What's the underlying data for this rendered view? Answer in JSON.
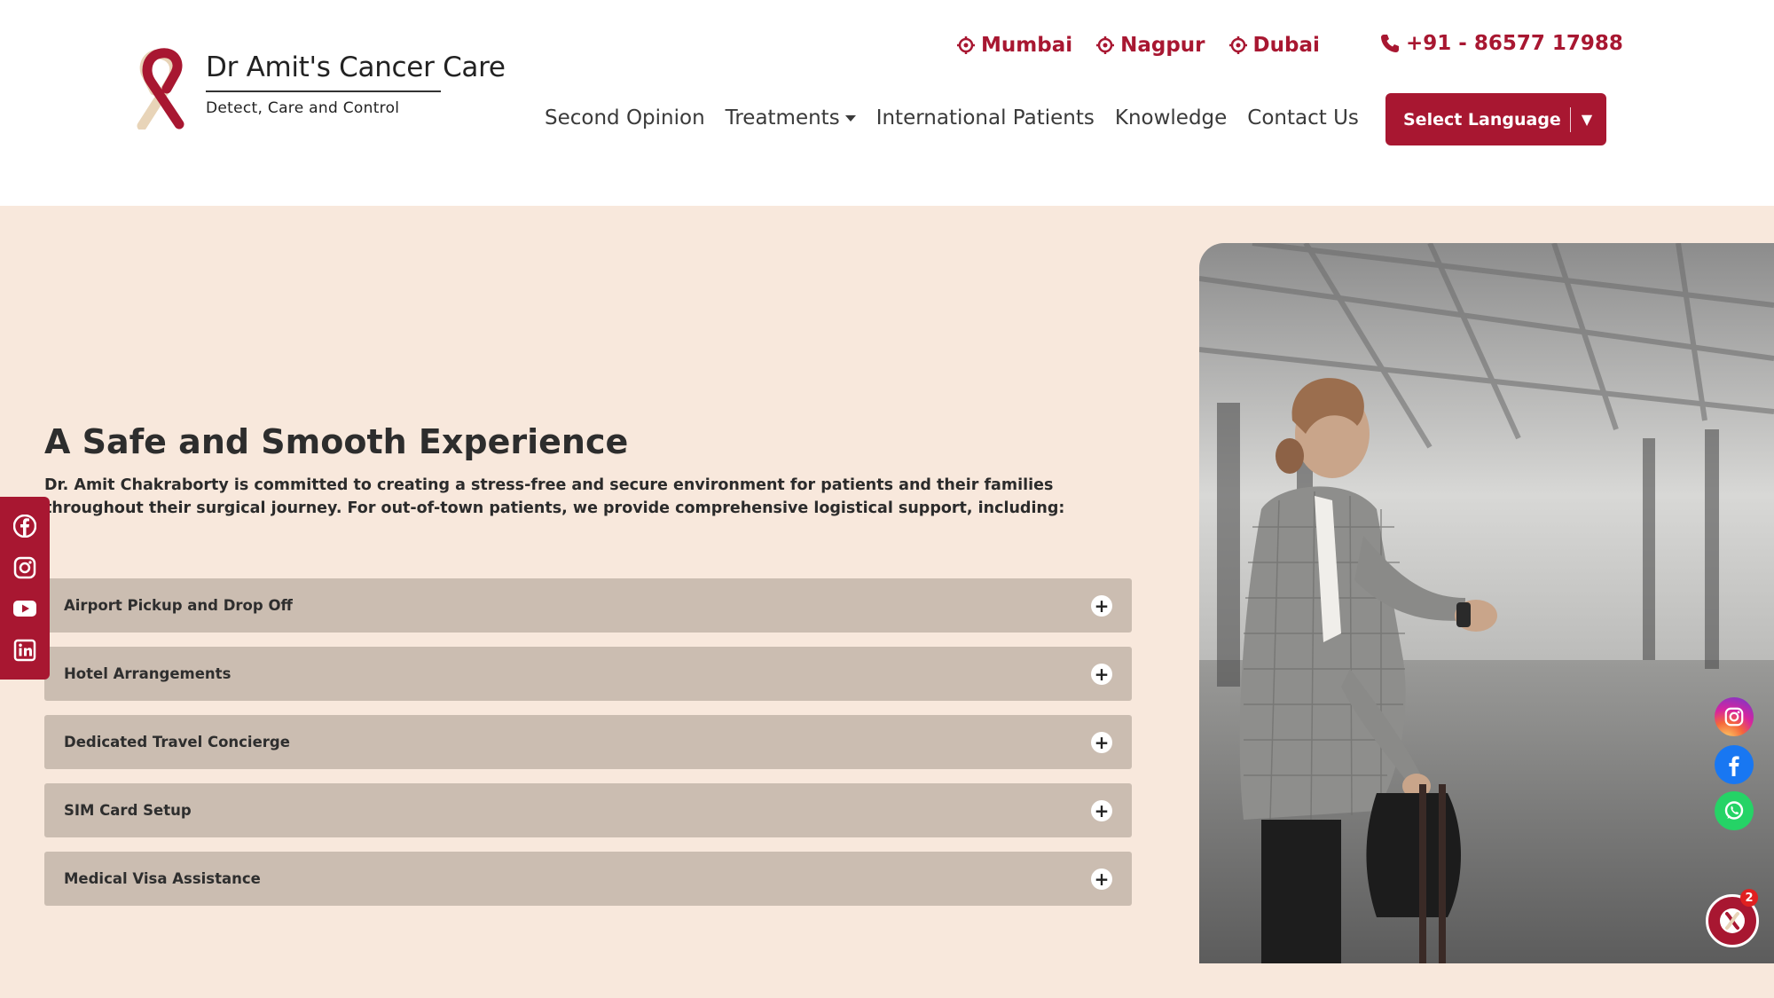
{
  "brand": {
    "name": "Dr Amit's Cancer Care",
    "tagline": "Detect, Care and Control"
  },
  "locations": [
    {
      "label": "Mumbai"
    },
    {
      "label": "Nagpur"
    },
    {
      "label": "Dubai"
    }
  ],
  "phone": "+91 - 86577 17988",
  "nav": {
    "items": [
      {
        "label": "Second Opinion"
      },
      {
        "label": "Treatments"
      },
      {
        "label": "International Patients"
      },
      {
        "label": "Knowledge"
      },
      {
        "label": "Contact Us"
      }
    ],
    "language_button": "Select Language",
    "language_arrow": "▼"
  },
  "section": {
    "heading": "A Safe and Smooth Experience",
    "intro": "Dr. Amit Chakraborty is committed to creating a stress-free and secure environment for patients and their families throughout their surgical journey. For out-of-town patients, we provide comprehensive logistical support, including:",
    "accordion": [
      {
        "label": "Airport Pickup and Drop Off"
      },
      {
        "label": "Hotel Arrangements"
      },
      {
        "label": "Dedicated Travel Concierge"
      },
      {
        "label": "SIM Card Setup"
      },
      {
        "label": "Medical Visa Assistance"
      }
    ],
    "plus_symbol": "+"
  },
  "social_left": [
    "facebook-icon",
    "instagram-icon",
    "youtube-icon",
    "linkedin-icon"
  ],
  "floating_right": [
    "instagram-icon",
    "facebook-icon",
    "whatsapp-icon"
  ],
  "chat": {
    "badge_count": "2"
  },
  "colors": {
    "brand_red": "#a81731",
    "section_bg": "#f8e8dc",
    "accordion_bg": "#cbbdb1"
  }
}
